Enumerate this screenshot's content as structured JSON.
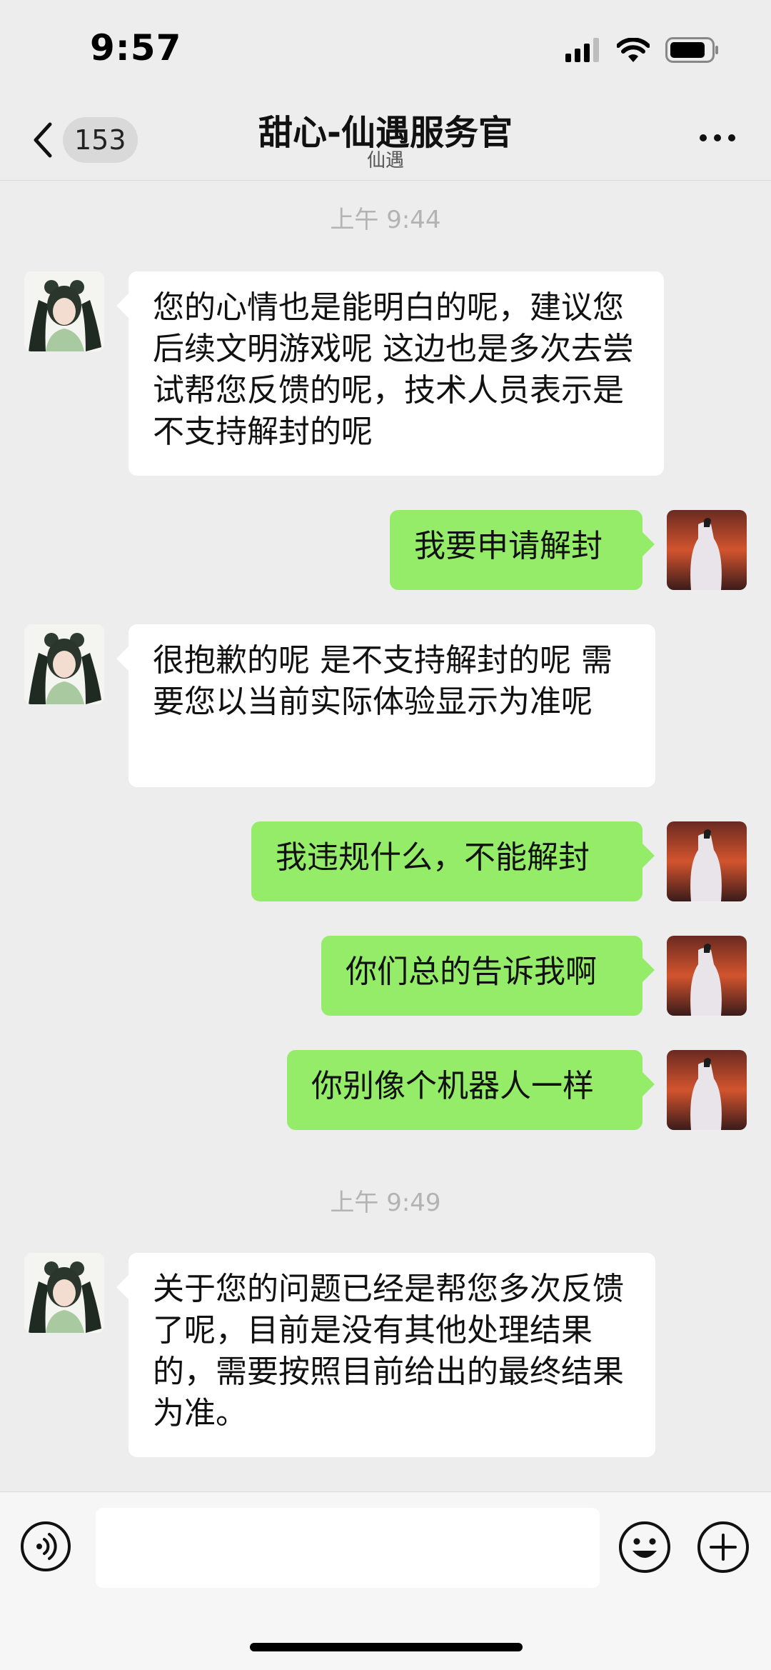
{
  "status_bar": {
    "time": "9:57"
  },
  "header": {
    "back_badge": "153",
    "title": "甜心-仙遇服务官",
    "subtitle": "仙遇"
  },
  "messages": {
    "ts1": "上午 9:44",
    "m1": "您的心情也是能明白的呢，建议您后续文明游戏呢 这边也是多次去尝试帮您反馈的呢，技术人员表示是不支持解封的呢",
    "m2": "我要申请解封",
    "m3": "很抱歉的呢 是不支持解封的呢 需要您以当前实际体验显示为准呢",
    "m4": "我违规什么，不能解封",
    "m5": "你们总的告诉我啊",
    "m6": "你别像个机器人一样",
    "ts2": "上午 9:49",
    "m7": "关于您的问题已经是帮您多次反馈了呢，目前是没有其他处理结果的，需要按照目前给出的最终结果为准。"
  },
  "input_bar": {
    "value": ""
  },
  "colors": {
    "background": "#ededed",
    "incoming_bubble": "#ffffff",
    "outgoing_bubble": "#95ec69",
    "timestamp": "#b3b3b3"
  },
  "icons": [
    "cellular-signal-icon",
    "wifi-icon",
    "battery-icon",
    "chevron-left-icon",
    "more-dots-icon",
    "voice-icon",
    "emoji-icon",
    "plus-icon",
    "agent-avatar",
    "user-avatar"
  ]
}
